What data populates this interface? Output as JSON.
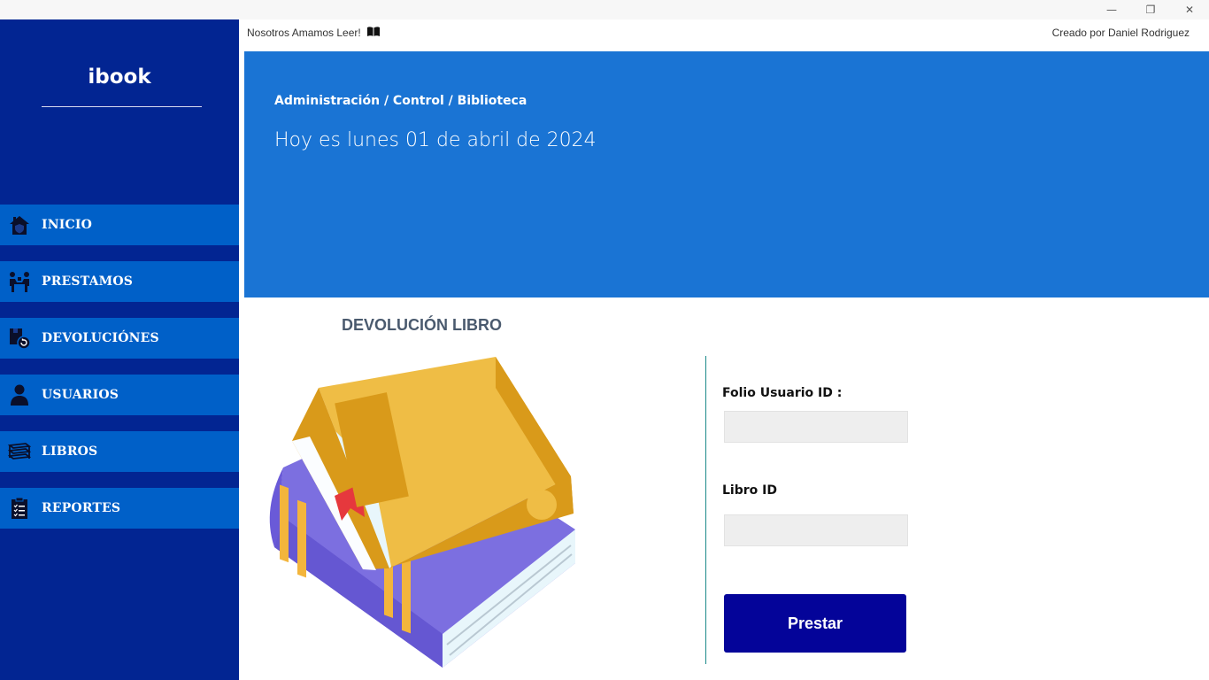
{
  "window": {
    "minimize": "—",
    "maximize": "❐",
    "close": "✕"
  },
  "sidebar": {
    "logo": "ibook",
    "items": [
      {
        "label": "INICIO",
        "icon": "home-shield-icon"
      },
      {
        "label": "PRESTAMOS",
        "icon": "people-exchange-icon"
      },
      {
        "label": "DEVOLUCIÓNES",
        "icon": "return-box-icon"
      },
      {
        "label": "USUARIOS",
        "icon": "user-icon"
      },
      {
        "label": "LIBROS",
        "icon": "books-icon"
      },
      {
        "label": "REPORTES",
        "icon": "clipboard-icon"
      }
    ]
  },
  "topbar": {
    "tagline": "Nosotros Amamos Leer!",
    "tagline_icon": "open-book-icon",
    "credit": "Creado por Daniel Rodriguez"
  },
  "banner": {
    "breadcrumb": "Administración / Control / Biblioteca",
    "date": "Hoy es lunes 01 de abril de 2024"
  },
  "form": {
    "title": "DEVOLUCIÓN LIBRO",
    "folio_label": "Folio Usuario ID :",
    "folio_value": "",
    "libro_label": "Libro ID",
    "libro_value": "",
    "submit_label": "Prestar"
  },
  "colors": {
    "sidebar_bg": "#022592",
    "nav_item_bg": "#0060c8",
    "banner_bg": "#1a74d4",
    "button_bg": "#040499",
    "divider": "#1b8a8a"
  }
}
